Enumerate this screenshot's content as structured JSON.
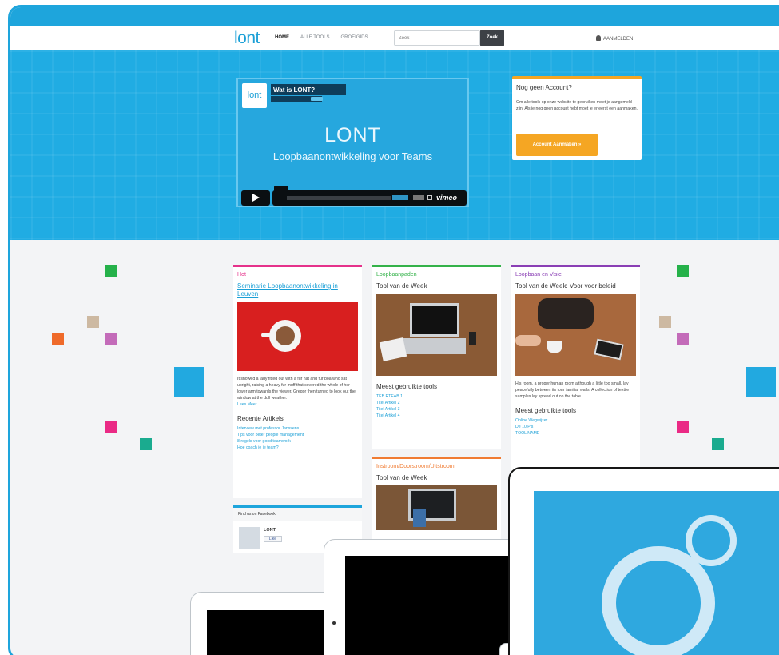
{
  "navbar": {
    "logo": "lont",
    "links": [
      "HOME",
      "ALLE TOOLS",
      "GROEIGIDS",
      "ZOEK"
    ],
    "search_placeholder": "Zoek",
    "search_button": "Zoek",
    "login": "AANMELDEN"
  },
  "video": {
    "badge_logo": "lont",
    "title": "Wat is LONT?",
    "big_title": "LONT",
    "subtitle": "Loopbaanontwikkeling voor Teams",
    "vimeo": "vimeo"
  },
  "account": {
    "title": "Nog geen Account?",
    "text": "Om alle tools op onze website te gebruiken moet je aangemeld zijn. Als je nog geen account hebt moet je er eerst een aanmaken.",
    "button": "Account Aanmaken »"
  },
  "cards": {
    "hot": {
      "head": "Hot",
      "link": "Seminarie Loopbaanontwikkeling in Leuven",
      "text": "It showed a lady fitted out with a fur hat and fur boa who sat upright, raising a heavy fur muff that covered the whole of her lower arm towards the viewer. Gregor then turned to look out the window at the dull weather.",
      "more": "Lees Meer...",
      "recent_head": "Recente Artikels",
      "recent": [
        "Interview met professor Janssens",
        "Tips voor beter people management",
        "8 regels voor good teamwork",
        "Hoe coach je je team?"
      ]
    },
    "paths": {
      "head": "Loopbaanpaden",
      "h2": "Tool van de Week",
      "tools_head": "Meest gebruikte tools",
      "tools": [
        "TEB RTEAB 1",
        "Titel Artikel 2",
        "Titel Artikel 3",
        "Titel Artikel 4"
      ]
    },
    "vision": {
      "head": "Loopbaan en Visie",
      "h2": "Tool van de Week: Voor voor beleid",
      "text": "His room, a proper human room although a little too small, lay peacefully between its four familiar walls. A collection of textile samples lay spread out on the table.",
      "tools_head": "Meest gebruikte tools",
      "tools": [
        "Online Wegwijzer",
        "De 10 P's",
        "TOOL NAME"
      ]
    },
    "flow": {
      "head": "Instroom/Doorstroom/Uitstroom",
      "h2": "Tool van de Week"
    }
  },
  "facebook": {
    "head": "Find us on Facebook",
    "name": "LONT",
    "like": "Like"
  }
}
